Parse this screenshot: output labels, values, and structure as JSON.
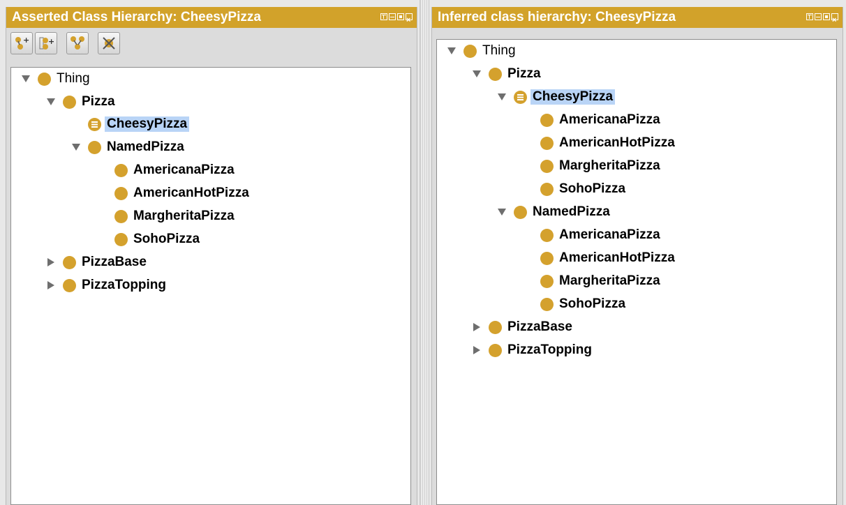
{
  "asserted_panel": {
    "title": "Asserted Class Hierarchy: CheesyPizza",
    "toolbar_icons": [
      "add-subclass-icon",
      "add-sibling-class-icon",
      "add-disjoint-icon",
      "delete-class-icon"
    ],
    "tree": {
      "thing": "Thing",
      "pizza": "Pizza",
      "cheesy_pizza": "CheesyPizza",
      "named_pizza": "NamedPizza",
      "americana": "AmericanaPizza",
      "american_hot": "AmericanHotPizza",
      "margherita": "MargheritaPizza",
      "soho": "SohoPizza",
      "pizza_base": "PizzaBase",
      "pizza_topping": "PizzaTopping"
    }
  },
  "inferred_panel": {
    "title": "Inferred class hierarchy: CheesyPizza",
    "tree": {
      "thing": "Thing",
      "pizza": "Pizza",
      "cheesy_pizza": "CheesyPizza",
      "cheesy_americana": "AmericanaPizza",
      "cheesy_american_hot": "AmericanHotPizza",
      "cheesy_margherita": "MargheritaPizza",
      "cheesy_soho": "SohoPizza",
      "named_pizza": "NamedPizza",
      "named_americana": "AmericanaPizza",
      "named_american_hot": "AmericanHotPizza",
      "named_margherita": "MargheritaPizza",
      "named_soho": "SohoPizza",
      "pizza_base": "PizzaBase",
      "pizza_topping": "PizzaTopping"
    }
  },
  "colors": {
    "title_bar": "#d2a22a",
    "class_dot": "#d4a12d",
    "selection": "#b9d4f6"
  }
}
